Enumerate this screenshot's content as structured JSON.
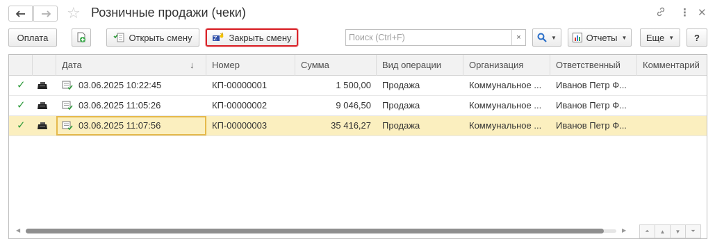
{
  "window": {
    "title": "Розничные продажи (чеки)",
    "icons": [
      "back-arrow-icon",
      "forward-arrow-icon",
      "star-icon",
      "link-icon",
      "more-vertical-icon",
      "close-icon"
    ]
  },
  "toolbar": {
    "payment_label": "Оплата",
    "create_icon": "add-document-icon",
    "open_shift_label": "Открыть смену",
    "close_shift_label": "Закрыть смену",
    "search_placeholder": "Поиск (Ctrl+F)",
    "search_clear": "×",
    "reports_label": "Отчеты",
    "more_label": "Еще",
    "help_label": "?"
  },
  "table": {
    "columns": [
      "Дата",
      "Номер",
      "Сумма",
      "Вид операции",
      "Организация",
      "Ответственный",
      "Комментарий"
    ],
    "sort_indicator": "↓",
    "rows": [
      {
        "date": "03.06.2025 10:22:45",
        "number": "КП-00000001",
        "amount": "1 500,00",
        "operation": "Продажа",
        "organization": "Коммунальное ...",
        "responsible": "Иванов Петр Ф...",
        "comment": ""
      },
      {
        "date": "03.06.2025 11:05:26",
        "number": "КП-00000002",
        "amount": "9 046,50",
        "operation": "Продажа",
        "organization": "Коммунальное ...",
        "responsible": "Иванов Петр Ф...",
        "comment": ""
      },
      {
        "date": "03.06.2025 11:07:56",
        "number": "КП-00000003",
        "amount": "35 416,27",
        "operation": "Продажа",
        "organization": "Коммунальное ...",
        "responsible": "Иванов Петр Ф...",
        "comment": ""
      }
    ],
    "selected_row": 3
  },
  "colors": {
    "accent_highlight": "#d9252b",
    "selected_row": "#fbefbf",
    "check": "#2e9a3a"
  }
}
